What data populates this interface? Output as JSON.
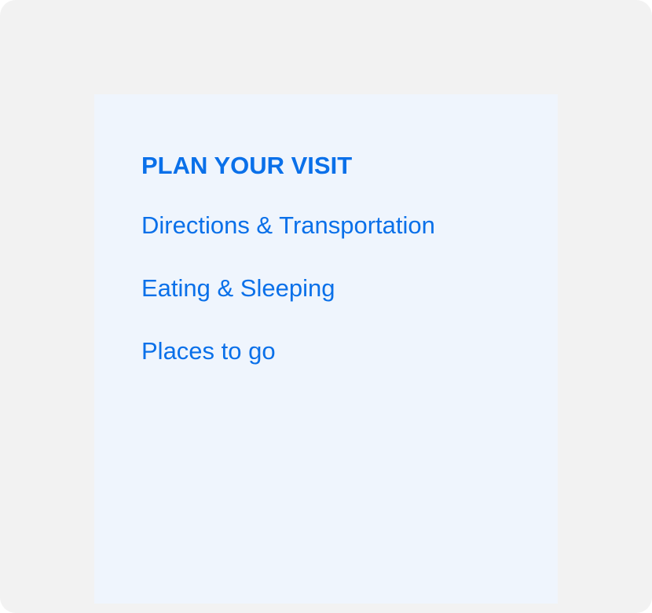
{
  "menu": {
    "title": "PLAN YOUR VISIT",
    "links": [
      {
        "label": "Directions & Transportation"
      },
      {
        "label": "Eating & Sleeping"
      },
      {
        "label": "Places to go"
      }
    ]
  },
  "colors": {
    "background": "#f2f2f2",
    "panel": "#eff5fd",
    "accent": "#0a70e9"
  }
}
